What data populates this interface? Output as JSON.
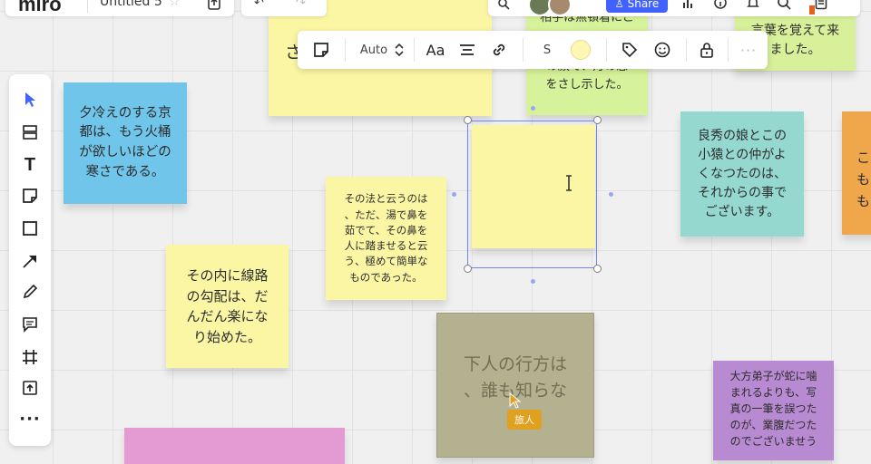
{
  "header": {
    "logo": "miro",
    "board_title": "Untitled 5",
    "share_label": "Share",
    "share_color": "#4262ff",
    "icons": [
      "star-icon",
      "export-icon",
      "stats-icon",
      "info-icon",
      "bell-icon",
      "search-icon",
      "notes-icon"
    ]
  },
  "context_toolbar": {
    "font_size": "Auto",
    "font_label": "Aa",
    "size_label": "S",
    "selected_color": "#fff6b6",
    "icons": [
      "sticky-note-type-icon",
      "stepper-icon",
      "text-align-icon",
      "link-icon",
      "tag-icon",
      "emoji-icon",
      "lock-icon",
      "more-icon"
    ]
  },
  "left_toolbar": {
    "tools": [
      "select-icon",
      "templates-icon",
      "text-icon",
      "sticky-note-icon",
      "shape-icon",
      "connection-line-icon",
      "pen-icon",
      "comment-icon",
      "frame-icon",
      "upload-icon",
      "more-tools-icon"
    ]
  },
  "notes": {
    "n1": "夕冷えのする京\n都は、もう火桶\nが欲しいほどの\n寒さである。",
    "n2": "その内に線路\nの勾配は、だ\nんだん楽にな\nり始めた。",
    "n3": "その法と云うのは\n、ただ、湯で鼻を\n茹でて、その鼻を\n人に踏ませると云\nう、極めて簡単な\nものであった。",
    "n4_partial": "さ",
    "n5_partial_top": "相手は無頓着にこ",
    "n5": "の顔で、灯の窓\nをさし示した。",
    "n6": "言葉を覚えて来\nました。",
    "n7": "良秀の娘とこの\n小猿との仲がよ\nくなつたのは、\nそれからの事で\nございます。",
    "n8_partial": "こ\nも\nも",
    "n9": "下人の行方は\n、誰も知らな",
    "n10": "大方弟子が蛇に噛\nまれるよりも、写\n真の一筆を誤つた\nのが、業腹だつた\nのでございませう"
  },
  "collaborator": {
    "name": "旅人",
    "color": "#e0a020"
  }
}
